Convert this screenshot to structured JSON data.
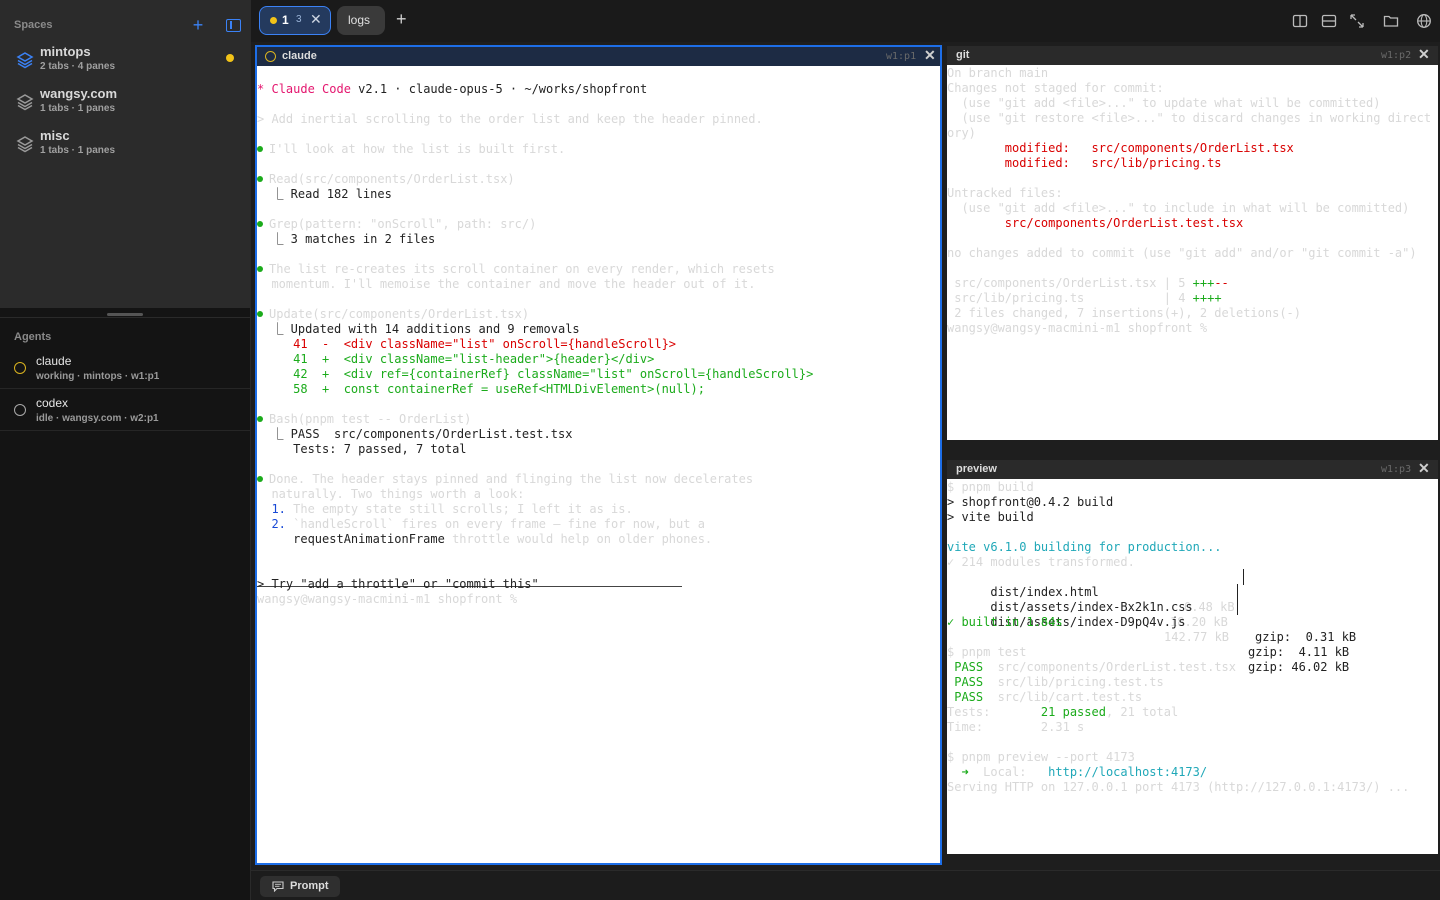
{
  "colors": {
    "accent": "#3b82f6",
    "working_dot": "#f2c318",
    "active_pane_border": "#1d6ee8"
  },
  "sidebar": {
    "spaces_title": "Spaces",
    "spaces": [
      {
        "name": "mintops",
        "meta": "2 tabs  ·  4 panes",
        "active": true
      },
      {
        "name": "wangsy.com",
        "meta": "1 tabs  ·  1 panes"
      },
      {
        "name": "misc",
        "meta": "1 tabs  ·  1 panes"
      }
    ],
    "agents_title": "Agents",
    "agents": [
      {
        "name": "claude",
        "meta": "working · mintops · w1:p1",
        "status": "working"
      },
      {
        "name": "codex",
        "meta": "idle · wangsy.com · w2:p1",
        "status": "idle"
      }
    ]
  },
  "tabs": {
    "active": {
      "number": "1",
      "count": "3"
    },
    "other": "logs",
    "add_label": "+"
  },
  "toolbar_icons": [
    "split-vertical-icon",
    "split-horizontal-icon",
    "expand-icon",
    "folder-icon",
    "globe-icon"
  ],
  "panes": {
    "claude": {
      "title": "claude",
      "id": "w1:p1",
      "lines": {
        "header_brand": "Claude Code",
        "header_rest": " v2.1 · claude-opus-5 · ~/works/shopfront",
        "user_prompt": "> Add inertial scrolling to the order list and keep the header pinned.",
        "m1": "I'll look at how the list is built first.",
        "read_call": "Read(src/components/OrderList.tsx)",
        "read_result": "  ⎿ Read 182 lines",
        "grep_call": "Grep(pattern: \"onScroll\", path: src/)",
        "grep_result": "  ⎿ 3 matches in 2 files",
        "m2a": "The list re-creates its scroll container on every render, which resets",
        "m2b": "  momentum. I'll memoise the container and move the header out of it.",
        "update_call": "Update(src/components/OrderList.tsx)",
        "update_result": "  ⎿ Updated with 14 additions and 9 removals",
        "diff1": "     41  -  <div className=\"list\" onScroll={handleScroll}>",
        "diff2": "     41  +  <div className=\"list-header\">{header}</div>",
        "diff3": "     42  +  <div ref={containerRef} className=\"list\" onScroll={handleScroll}>",
        "diff4": "     58  +  const containerRef = useRef<HTMLDivElement>(null);",
        "bash_call": "Bash(pnpm test -- OrderList)",
        "bash_r1": "  ⎿ PASS  src/components/OrderList.test.tsx",
        "bash_r2": "     Tests: 7 passed, 7 total",
        "done_a": "Done. The header stays pinned and flinging the list now decelerates",
        "done_b": "  naturally. Two things worth a look:",
        "item1_num": "  1.",
        "item1_text": " The empty state still scrolls; I left it as is.",
        "item2_num": "  2.",
        "item2_text": " `handleScroll` fires on every frame — fine for now, but a",
        "item2_c_plain": "     requestAnimationFrame",
        "item2_c_faint": " throttle would help on older phones.",
        "input_hint": "> Try \"add a throttle\" or \"commit this\"",
        "shell_prompt": "wangsy@wangsy-macmini-m1 shopfront %"
      }
    },
    "git": {
      "title": "git",
      "id": "w1:p2",
      "lines": {
        "l1": "On branch main",
        "l2": "Changes not staged for commit:",
        "l3": "  (use \"git add <file>...\" to update what will be committed)",
        "l4": "  (use \"git restore <file>...\" to discard changes in working direct",
        "l5": "ory)",
        "mod1": "        modified:   src/components/OrderList.tsx",
        "mod2": "        modified:   src/lib/pricing.ts",
        "l8": "Untracked files:",
        "l9": "  (use \"git add <file>...\" to include in what will be committed)",
        "untracked": "        src/components/OrderList.test.tsx",
        "l11": "no changes added to commit (use \"git add\" and/or \"git commit -a\")",
        "stat1_file": " src/components/OrderList.tsx | 5 ",
        "stat1_plus": "+++",
        "stat1_minus": "--",
        "stat2_file": " src/lib/pricing.ts           | 4 ",
        "stat2_plus": "++++",
        "stat3": " 2 files changed, 7 insertions(+), 2 deletions(-)",
        "prompt": "wangsy@wangsy-macmini-m1 shopfront %"
      }
    },
    "preview": {
      "title": "preview",
      "id": "w1:p3",
      "lines": {
        "c1": "$ pnpm build",
        "b1": "> shopfront@0.4.2 build",
        "b2": "> vite build",
        "vite": "vite v6.1.0 building for production...",
        "transformed": "✓ 214 modules transformed.",
        "f1_name": "dist/index.html",
        "f1_size": "0.48 kB",
        "f1_gzip": "gzip:  0.31 kB",
        "f2_name": "dist/assets/index-Bx2k1n.css",
        "f2_size": "18.20 kB",
        "f2_gzip": "gzip:  4.11 kB",
        "f3_name": "dist/assets/index-D9pQ4v.js",
        "f3_size": "142.77 kB",
        "f3_gzip": "gzip: 46.02 kB",
        "built": "✓ built in 1.84s",
        "c2": "$ pnpm test",
        "pass_label": " PASS",
        "t1": "src/components/OrderList.test.tsx",
        "t2": "src/lib/pricing.test.ts",
        "t3": "src/lib/cart.test.ts",
        "tests_label": "Tests:       ",
        "tests_passed": "21 passed",
        "tests_total": ", 21 total",
        "time_line": "Time:        2.31 s",
        "c3": "$ pnpm preview --port 4173",
        "local_arrow": "  ➜  ",
        "local_label": "Local:   ",
        "local_url": "http://localhost:4173/",
        "serving": "Serving HTTP on 127.0.0.1 port 4173 (http://127.0.0.1:4173/) ..."
      }
    }
  },
  "bottom": {
    "prompt_label": "Prompt"
  }
}
